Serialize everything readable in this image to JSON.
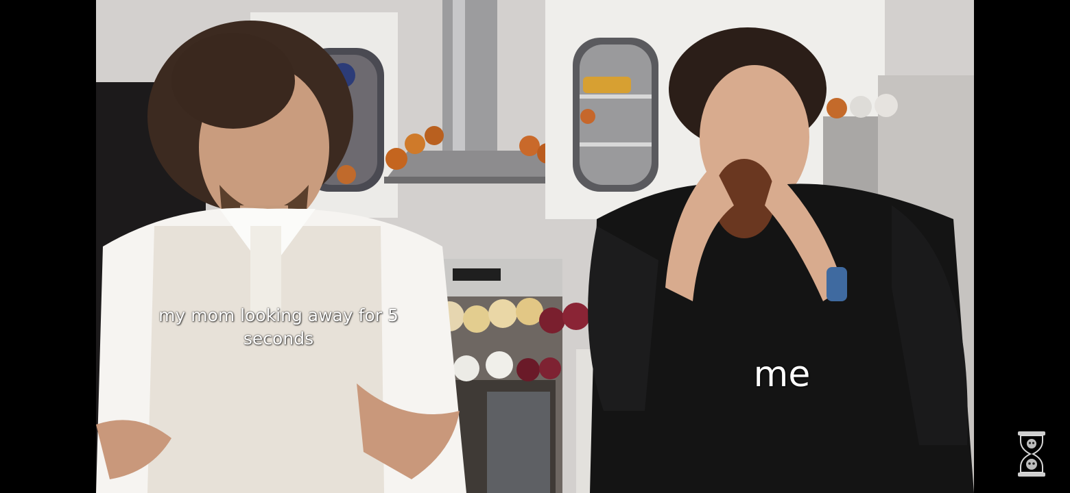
{
  "meme": {
    "caption_left": "my mom looking away for 5 seconds",
    "caption_right": "me"
  },
  "icons": {
    "watermark": "hourglass-skull-icon"
  },
  "colors": {
    "letterbox": "#000000",
    "caption_text": "#ffffff"
  }
}
